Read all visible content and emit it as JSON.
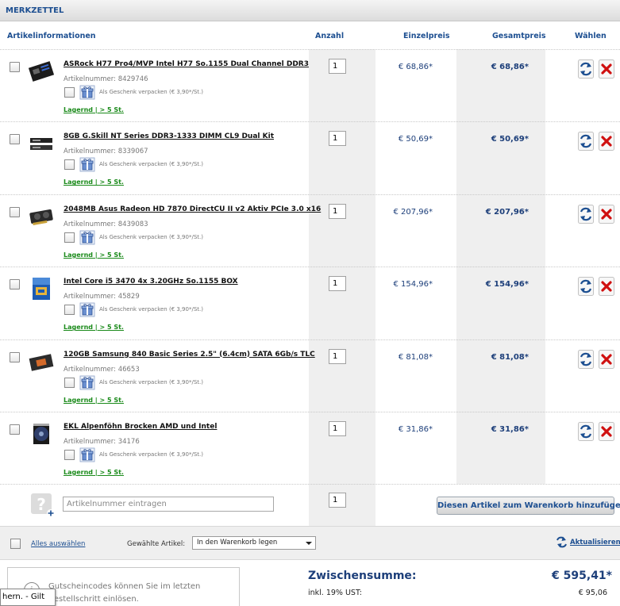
{
  "header": {
    "title": "MERKZETTEL"
  },
  "columns": {
    "info": "Artikelinformationen",
    "qty": "Anzahl",
    "unit_price": "Einzelpreis",
    "total_price": "Gesamtpreis",
    "choose": "Wählen"
  },
  "items": [
    {
      "name": "ASRock H77 Pro4/MVP Intel H77 So.1155 Dual Channel DDR3",
      "artnr": "Artikelnummer: 8429746",
      "gift": "Als Geschenk verpacken (€ 3,90*/St.)",
      "stock": "Lagernd | > 5 St.",
      "qty": "1",
      "unit_price": "€ 68,86*",
      "total_price": "€ 68,86*",
      "thumb": "motherboard"
    },
    {
      "name": "8GB G.Skill NT Series DDR3-1333 DIMM CL9 Dual Kit",
      "artnr": "Artikelnummer: 8339067",
      "gift": "Als Geschenk verpacken (€ 3,90*/St.)",
      "stock": "Lagernd | > 5 St.",
      "qty": "1",
      "unit_price": "€ 50,69*",
      "total_price": "€ 50,69*",
      "thumb": "ram"
    },
    {
      "name": "2048MB Asus Radeon HD 7870 DirectCU II v2 Aktiv PCIe 3.0 x16",
      "artnr": "Artikelnummer: 8439083",
      "gift": "Als Geschenk verpacken (€ 3,90*/St.)",
      "stock": "Lagernd | > 5 St.",
      "qty": "1",
      "unit_price": "€ 207,96*",
      "total_price": "€ 207,96*",
      "thumb": "gpu"
    },
    {
      "name": "Intel Core i5 3470 4x 3.20GHz So.1155 BOX",
      "artnr": "Artikelnummer: 45829",
      "gift": "Als Geschenk verpacken (€ 3,90*/St.)",
      "stock": "Lagernd | > 5 St.",
      "qty": "1",
      "unit_price": "€ 154,96*",
      "total_price": "€ 154,96*",
      "thumb": "cpu-box"
    },
    {
      "name": "120GB Samsung 840 Basic Series 2.5\" (6.4cm) SATA 6Gb/s TLC",
      "artnr": "Artikelnummer: 46653",
      "gift": "Als Geschenk verpacken (€ 3,90*/St.)",
      "stock": "Lagernd | > 5 St.",
      "qty": "1",
      "unit_price": "€ 81,08*",
      "total_price": "€ 81,08*",
      "thumb": "ssd"
    },
    {
      "name": "EKL Alpenföhn Brocken AMD und Intel",
      "artnr": "Artikelnummer: 34176",
      "gift": "Als Geschenk verpacken (€ 3,90*/St.)",
      "stock": "Lagernd | > 5 St.",
      "qty": "1",
      "unit_price": "€ 31,86*",
      "total_price": "€ 31,86*",
      "thumb": "cooler"
    }
  ],
  "add_row": {
    "artnr_placeholder": "Artikelnummer eintragen",
    "qty": "1",
    "add_button": "Diesen Artikel zum Warenkorb hinzufügen"
  },
  "actions": {
    "select_all": "Alles auswählen",
    "selected_label": "Gewählte Artikel:",
    "selected_action": "In den Warenkorb legen",
    "update": "Aktualisieren"
  },
  "coupon": {
    "line1": "Gutscheincodes können Sie im letzten",
    "line2": "Bestellschritt einlösen."
  },
  "summary": {
    "subtotal_label": "Zwischensumme:",
    "subtotal_value": "€ 595,41*",
    "vat_label": "inkl. 19% UST:",
    "vat_value": "€ 95,06"
  },
  "tooltip": {
    "text": "hern. - Gilt"
  },
  "colors": {
    "brand": "#1d4f91",
    "price": "#1d3f7a",
    "stock": "#1a8a1a",
    "delete": "#d01010"
  }
}
